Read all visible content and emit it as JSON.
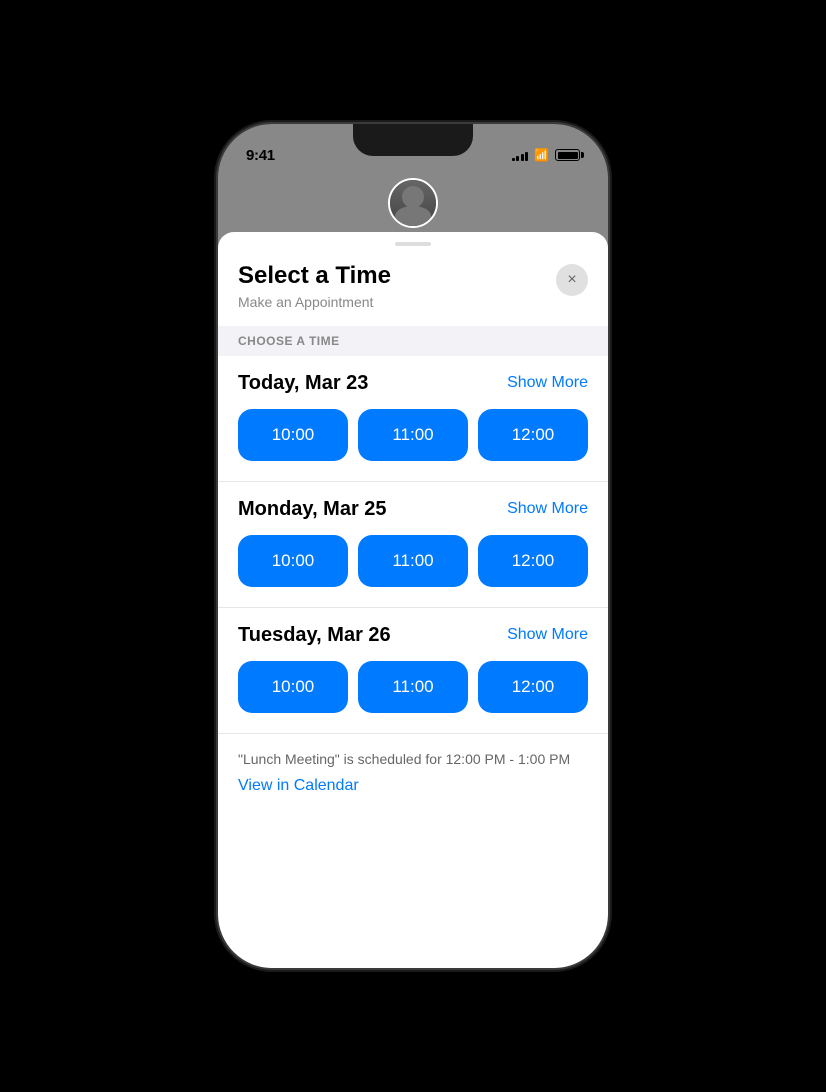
{
  "statusBar": {
    "time": "9:41",
    "signalBars": [
      3,
      5,
      7,
      9,
      11
    ],
    "batteryFull": true
  },
  "sheet": {
    "handle": true,
    "title": "Select a Time",
    "subtitle": "Make an Appointment",
    "closeButton": "×",
    "sectionHeader": "CHOOSE A TIME"
  },
  "days": [
    {
      "label": "Today, Mar 23",
      "showMore": "Show More",
      "slots": [
        "10:00",
        "11:00",
        "12:00"
      ]
    },
    {
      "label": "Monday, Mar 25",
      "showMore": "Show More",
      "slots": [
        "10:00",
        "11:00",
        "12:00"
      ]
    },
    {
      "label": "Tuesday, Mar 26",
      "showMore": "Show More",
      "slots": [
        "10:00",
        "11:00",
        "12:00"
      ]
    }
  ],
  "conflict": {
    "note": "\"Lunch Meeting\" is scheduled for 12:00 PM - 1:00 PM",
    "calendarLink": "View in Calendar"
  }
}
